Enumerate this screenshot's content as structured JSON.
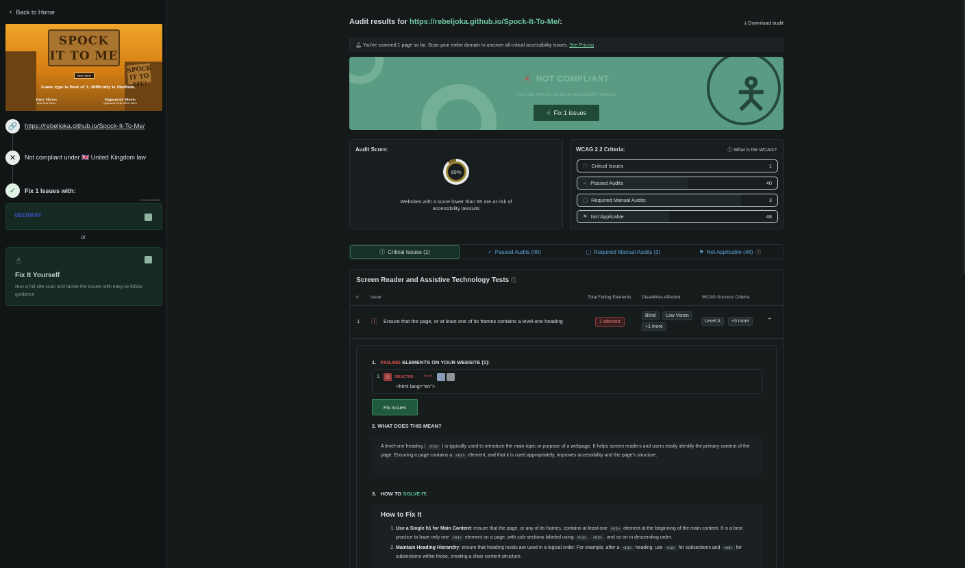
{
  "sidebar": {
    "back_label": "Back to Home",
    "thumbnail": {
      "title": "SPOCK IT TO ME",
      "sign_right": "SPOCK IT TO ME!",
      "button": "New Game",
      "game_text": "Game type is Best of 3, Difficulty is Medium.",
      "your_move": "Your Move:",
      "your_move_sub": "Pick Your Move",
      "opponent_move": "Opponent Move:",
      "opponent_move_sub": "Opponent Picks Their Move"
    },
    "url": "https://rebeljoka.github.io/Spock-It-To-Me/",
    "compliance_prefix": "Not compliant under",
    "compliance_flag": "🇬🇧",
    "compliance_law": "United Kingdom law",
    "fix_label": "Fix 1 Issues with:",
    "sponsored": "SPONSORED",
    "sponsor_logo": "USERWAY",
    "or": "or",
    "fix_yourself_title": "Fix It Yourself",
    "fix_yourself_desc": "Run a full site scan and tackle the issues with easy-to-follow guidance"
  },
  "header": {
    "title_prefix": "Audit results for",
    "title_url": "https://rebeljoka.github.io/Spock-It-To-Me/",
    "title_suffix": ":",
    "download": "Download audit"
  },
  "notice": {
    "text": "You've scanned 1 page so far. Scan your entire domain to uncover all critical accessibility issues.",
    "link": "See Pricing"
  },
  "banner": {
    "status": "NOT COMPLIANT",
    "risk": "Your site may be at risk of accessibility lawsuits",
    "button": "Fix 1 issues"
  },
  "score": {
    "title": "Audit Score:",
    "value": "89%",
    "percent": 89,
    "note": "Websites with a score lower than 95 are at risk of accessibility lawsuits"
  },
  "wcag": {
    "title": "WCAG 2.2 Criteria:",
    "help": "What is the WCAG?",
    "rows": [
      {
        "label": "Critical Issues",
        "count": "1",
        "icon": "ⓘ"
      },
      {
        "label": "Passed Audits",
        "count": "40",
        "icon": "✓"
      },
      {
        "label": "Required Manual Audits",
        "count": "3",
        "icon": "▢"
      },
      {
        "label": "Not Applicable",
        "count": "48",
        "icon": "⚑"
      }
    ]
  },
  "tabs": [
    {
      "label": "Critical Issues (1)"
    },
    {
      "label": "Passed Audits (40)"
    },
    {
      "label": "Required Manual Audits (3)"
    },
    {
      "label": "Not Applicable (48)"
    }
  ],
  "table": {
    "title": "Screen Reader and Assistive Technology Tests",
    "columns": [
      "#",
      "Issue",
      "Total Failing Elements",
      "Disabilities Affected",
      "WCAG Success Criteria"
    ],
    "rows": [
      {
        "num": "1",
        "issue": "Ensure that the page, or at least one of its frames contains a level-one heading",
        "failing": "1 element",
        "disabilities": [
          "Blind",
          "Low Vision",
          "+1 more"
        ],
        "criteria": [
          "Level A",
          "+3 more"
        ]
      }
    ]
  },
  "detail": {
    "s1_num": "1.",
    "s1_red": "FAILING",
    "s1_rest": "ELEMENTS ON YOUR WEBSITE (1):",
    "selector_num": "1.",
    "selector_label": "SELECTOR:",
    "selector_value": "html",
    "element": "<html lang=\"en\">",
    "fix_button": "Fix issues",
    "s2": "2.   WHAT DOES THIS MEAN?",
    "mean_1": "A level-one heading (",
    "mean_code1": "<h1>",
    "mean_2": ") is typically used to introduce the main topic or purpose of a webpage. It helps screen readers and users easily identify the primary content of the page. Ensuring a page contains a",
    "mean_code2": "<h1>",
    "mean_3": "element, and that it is used appropriately, improves accessibility and the page's structure.",
    "s3_num": "3.",
    "s3_pre": "HOW TO",
    "s3_green": "SOLVE IT",
    "s3_post": ":",
    "how_title": "How to Fix It",
    "li1_bold": "Use a Single h1 for Main Content",
    "li1_a": ": ensure that the page, or any of its frames, contains at least one",
    "li1_code1": "<h1>",
    "li1_b": "element at the beginning of the main content. It is a best practice to have only one",
    "li1_code2": "<h1>",
    "li1_c": "element on a page, with sub-sections labeled using",
    "li1_code3": "<h2>",
    "li1_code4": "<h3>",
    "li1_d": ", and so on in descending order.",
    "li2_bold": "Maintain Heading Hierarchy",
    "li2_a": ": ensure that heading levels are used in a logical order. For example, after a",
    "li2_code1": "<h1>",
    "li2_b": "heading, use",
    "li2_code2": "<h2>",
    "li2_c": "for subsections and",
    "li2_code3": "<h3>",
    "li2_d": "for subsections within those, creating a clear content structure."
  }
}
